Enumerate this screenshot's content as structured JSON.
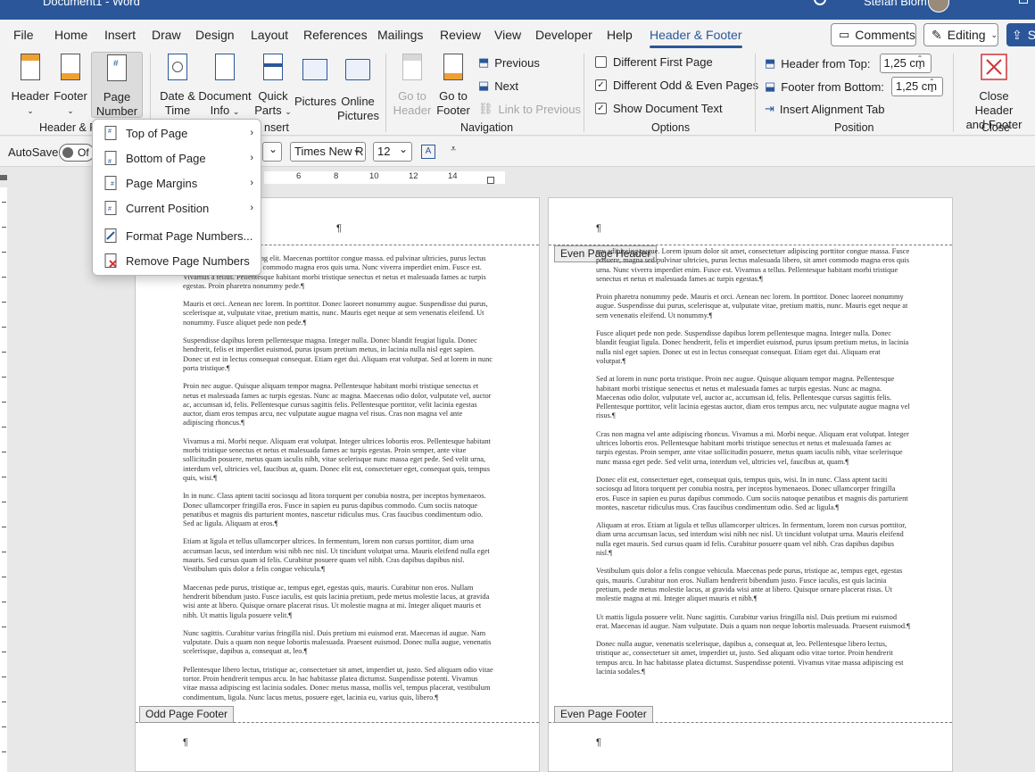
{
  "titlebar": {
    "doc_title": "Document1 - Word",
    "user": "Stefan Blom"
  },
  "menu": {
    "tabs": [
      "File",
      "Home",
      "Insert",
      "Draw",
      "Design",
      "Layout",
      "References",
      "Mailings",
      "Review",
      "View",
      "Developer",
      "Help",
      "Header & Footer"
    ],
    "active_tab": "Header & Footer",
    "comments": "Comments",
    "editing": "Editing",
    "share": "S"
  },
  "ribbon": {
    "header": "Header",
    "footer": "Footer",
    "page_number_line1": "Page",
    "page_number_line2": "Number",
    "group_header_footer": "Header & F",
    "date_time_line1": "Date &",
    "date_time_line2": "Time",
    "document_info_line1": "Document",
    "document_info_line2": "Info",
    "quick_parts_line1": "Quick",
    "quick_parts_line2": "Parts",
    "pictures": "Pictures",
    "online_pictures_line1": "Online",
    "online_pictures_line2": "Pictures",
    "group_insert": "nsert",
    "go_to_header_line1": "Go to",
    "go_to_header_line2": "Header",
    "go_to_footer_line1": "Go to",
    "go_to_footer_line2": "Footer",
    "previous": "Previous",
    "next": "Next",
    "link_to_previous": "Link to Previous",
    "group_navigation": "Navigation",
    "different_first_page": "Different First Page",
    "different_odd_even": "Different Odd & Even Pages",
    "show_document_text": "Show Document Text",
    "different_first_page_checked": false,
    "different_odd_even_checked": true,
    "show_document_text_checked": true,
    "group_options": "Options",
    "header_from_top": "Header from Top:",
    "header_from_top_value": "1,25 cm",
    "footer_from_bottom": "Footer from Bottom:",
    "footer_from_bottom_value": "1,25 cm",
    "insert_alignment_tab": "Insert Alignment Tab",
    "group_position": "Position",
    "close_line1": "Close Header",
    "close_line2": "and Footer",
    "group_close": "Close"
  },
  "qat": {
    "autosave": "AutoSave",
    "autosave_state": "Of",
    "font_name": "Times New R",
    "font_size": "12"
  },
  "ruler": {
    "marks": [
      "6",
      "8",
      "10",
      "12",
      "14"
    ]
  },
  "page_number_menu": {
    "items": [
      {
        "label": "Top of Page",
        "has_submenu": true
      },
      {
        "label": "Bottom of Page",
        "has_submenu": true
      },
      {
        "label": "Page Margins",
        "has_submenu": true
      },
      {
        "label": "Current Position",
        "has_submenu": true
      },
      {
        "label": "Format Page Numbers...",
        "has_submenu": false
      },
      {
        "label": "Remove Page Numbers",
        "has_submenu": false
      }
    ]
  },
  "pages": {
    "left_footer_tag": "Odd Page Footer",
    "right_header_tag": "Even Page Header",
    "right_footer_tag": "Even Page Footer",
    "pilcrow": "¶",
    "left_paragraphs": [
      "met, consectetuer adipiscing elit. Maecenas porttitor congue massa. ed pulvinar ultricies, purus lectus malesuada libero, sit amet commodo magna eros quis urna. Nunc viverra imperdiet enim. Fusce est. Vivamus a tellus. Pellentesque habitant morbi tristique senectus et netus et malesuada fames ac turpis egestas. Proin pharetra nonummy pede.¶",
      "Mauris et orci. Aenean nec lorem. In porttitor. Donec laoreet nonummy augue. Suspendisse dui purus, scelerisque at, vulputate vitae, pretium mattis, nunc. Mauris eget neque at sem venenatis eleifend. Ut nonummy. Fusce aliquet pede non pede.¶",
      "Suspendisse dapibus lorem pellentesque magna. Integer nulla. Donec blandit feugiat ligula. Donec hendrerit, felis et imperdiet euismod, purus ipsum pretium metus, in lacinia nulla nisl eget sapien. Donec ut est in lectus consequat consequat. Etiam eget dui. Aliquam erat volutpat. Sed at lorem in nunc porta tristique.¶",
      "Proin nec augue. Quisque aliquam tempor magna. Pellentesque habitant morbi tristique senectus et netus et malesuada fames ac turpis egestas. Nunc ac magna. Maecenas odio dolor, vulputate vel, auctor ac, accumsan id, felis. Pellentesque cursus sagittis felis. Pellentesque porttitor, velit lacinia egestas auctor, diam eros tempus arcu, nec vulputate augue magna vel risus. Cras non magna vel ante adipiscing rhoncus.¶",
      "Vivamus a mi. Morbi neque. Aliquam erat volutpat. Integer ultrices lobortis eros. Pellentesque habitant morbi tristique senectus et netus et malesuada fames ac turpis egestas. Proin semper, ante vitae sollicitudin posuere, metus quam iaculis nibh, vitae scelerisque nunc massa eget pede. Sed velit urna, interdum vel, ultricies vel, faucibus at, quam. Donec elit est, consectetuer eget, consequat quis, tempus quis, wisi.¶",
      "In in nunc. Class aptent taciti sociosqu ad litora torquent per conubia nostra, per inceptos hymenaeos. Donec ullamcorper fringilla eros. Fusce in sapien eu purus dapibus commodo. Cum sociis natoque penatibus et magnis dis parturient montes, nascetur ridiculus mus. Cras faucibus condimentum odio. Sed ac ligula. Aliquam at eros.¶",
      "Etiam at ligula et tellus ullamcorper ultrices. In fermentum, lorem non cursus porttitor, diam urna accumsan lacus, sed interdum wisi nibh nec nisl. Ut tincidunt volutpat urna. Mauris eleifend nulla eget mauris. Sed cursus quam id felis. Curabitur posuere quam vel nibh. Cras dapibus dapibus nisl. Vestibulum quis dolor a felis congue vehicula.¶",
      "Maecenas pede purus, tristique ac, tempus eget, egestas quis, mauris. Curabitur non eros. Nullam hendrerit bibendum justo. Fusce iaculis, est quis lacinia pretium, pede metus molestie lacus, at gravida wisi ante at libero. Quisque ornare placerat risus. Ut molestie magna at mi. Integer aliquet mauris et nibh. Ut mattis ligula posuere velit.¶",
      "Nunc sagittis. Curabitur varius fringilla nisl. Duis pretium mi euismod erat. Maecenas id augue. Nam vulputate. Duis a quam non neque lobortis malesuada. Praesent euismod. Donec nulla augue, venenatis scelerisque, dapibus a, consequat at, leo.¶",
      "Pellentesque libero lectus, tristique ac, consectetuer sit amet, imperdiet ut, justo. Sed aliquam odio vitae tortor. Proin hendrerit tempus arcu. In hac habitasse platea dictumst. Suspendisse potenti. Vivamus vitae massa adipiscing est lacinia sodales. Donec metus massa, mollis vel, tempus placerat, vestibulum condimentum, ligula. Nunc lacus metus, posuere eget, lacinia eu, varius quis, libero.¶"
    ],
    "right_paragraphs": [
      "my adipiscing augue. Lorem ipsum dolor sit amet, consectetuer adipiscing porttitor congue massa. Fusce posuere, magna sed pulvinar ultricies, purus lectus malesuada libero, sit amet commodo magna eros quis urna. Nunc viverra imperdiet enim. Fusce est. Vivamus a tellus. Pellentesque habitant morbi tristique senectus et netus et malesuada fames ac turpis egestas.¶",
      "Proin pharetra nonummy pede. Mauris et orci. Aenean nec lorem. In porttitor. Donec laoreet nonummy augue. Suspendisse dui purus, scelerisque at, vulputate vitae, pretium mattis, nunc. Mauris eget neque at sem venenatis eleifend. Ut nonummy.¶",
      "Fusce aliquet pede non pede. Suspendisse dapibus lorem pellentesque magna. Integer nulla. Donec blandit feugiat ligula. Donec hendrerit, felis et imperdiet euismod, purus ipsum pretium metus, in lacinia nulla nisl eget sapien. Donec ut est in lectus consequat consequat. Etiam eget dui. Aliquam erat volutpat.¶",
      "Sed at lorem in nunc porta tristique. Proin nec augue. Quisque aliquam tempor magna. Pellentesque habitant morbi tristique senectus et netus et malesuada fames ac turpis egestas. Nunc ac magna. Maecenas odio dolor, vulputate vel, auctor ac, accumsan id, felis. Pellentesque cursus sagittis felis. Pellentesque porttitor, velit lacinia egestas auctor, diam eros tempus arcu, nec vulputate augue magna vel risus.¶",
      "Cras non magna vel ante adipiscing rhoncus. Vivamus a mi. Morbi neque. Aliquam erat volutpat. Integer ultrices lobortis eros. Pellentesque habitant morbi tristique senectus et netus et malesuada fames ac turpis egestas. Proin semper, ante vitae sollicitudin posuere, metus quam iaculis nibh, vitae scelerisque nunc massa eget pede. Sed velit urna, interdum vel, ultricies vel, faucibus at, quam.¶",
      "Donec elit est, consectetuer eget, consequat quis, tempus quis, wisi. In in nunc. Class aptent taciti sociosqu ad litora torquent per conubia nostra, per inceptos hymenaeos. Donec ullamcorper fringilla eros. Fusce in sapien eu purus dapibus commodo. Cum sociis natoque penatibus et magnis dis parturient montes, nascetur ridiculus mus. Cras faucibus condimentum odio. Sed ac ligula.¶",
      "Aliquam at eros. Etiam at ligula et tellus ullamcorper ultrices. In fermentum, lorem non cursus porttitor, diam urna accumsan lacus, sed interdum wisi nibh nec nisl. Ut tincidunt volutpat urna. Mauris eleifend nulla eget mauris. Sed cursus quam id felis. Curabitur posuere quam vel nibh. Cras dapibus dapibus nisl.¶",
      "Vestibulum quis dolor a felis congue vehicula. Maecenas pede purus, tristique ac, tempus eget, egestas quis, mauris. Curabitur non eros. Nullam hendrerit bibendum justo. Fusce iaculis, est quis lacinia pretium, pede metus molestie lacus, at gravida wisi ante at libero. Quisque ornare placerat risus. Ut molestie magna at mi. Integer aliquet mauris et nibh.¶",
      "Ut mattis ligula posuere velit. Nunc sagittis. Curabitur varius fringilla nisl. Duis pretium mi euismod erat. Maecenas id augue. Nam vulputate. Duis a quam non neque lobortis malesuada. Praesent euismod.¶",
      "Donec nulla augue, venenatis scelerisque, dapibus a, consequat at, leo. Pellentesque libero lectus, tristique ac, consectetuer sit amet, imperdiet ut, justo. Sed aliquam odio vitae tortor. Proin hendrerit tempus arcu. In hac habitasse platea dictumst. Suspendisse potenti. Vivamus vitae massa adipiscing est lacinia sodales.¶"
    ]
  }
}
